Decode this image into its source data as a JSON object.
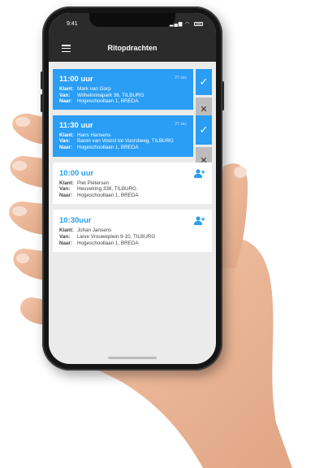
{
  "status": {
    "time": "9:41"
  },
  "nav": {
    "title": "Ritopdrachten"
  },
  "labels": {
    "client": "Klant:",
    "from": "Van:",
    "to": "Naar:"
  },
  "rides": [
    {
      "time": "11:00 uur",
      "ago": "27 sec",
      "client": "Mark van Gorp",
      "from": "Wilhelminapark 36, TILBURG",
      "to": "Hogeschoollaan 1, BREDA",
      "state": "accepted"
    },
    {
      "time": "11:30 uur",
      "ago": "27 sec",
      "client": "Hans Hansens",
      "from": "Baron van Voorst tot Voorstweg, TILBURG",
      "to": "Hogeschoollaan 1, BREDA",
      "state": "accepted"
    },
    {
      "time": "10:00 uur",
      "client": "Piet Pietersen",
      "from": "Heuvelring 338, TILBURG",
      "to": "Hogeschoollaan 1, BREDA",
      "state": "open"
    },
    {
      "time": "10:30uur",
      "client": "Johan Jansens",
      "from": "Lieve Vrouweplein 9-10, TILBURG",
      "to": "Hogeschoollaan 1, BREDA",
      "state": "open"
    }
  ],
  "colors": {
    "accent": "#2a9df4",
    "navbar": "#2b2b2b",
    "decline": "#bcbcbc"
  },
  "icons": [
    "menu-icon",
    "check-icon",
    "close-icon",
    "add-user-icon",
    "signal-icon",
    "wifi-icon",
    "battery-icon"
  ]
}
